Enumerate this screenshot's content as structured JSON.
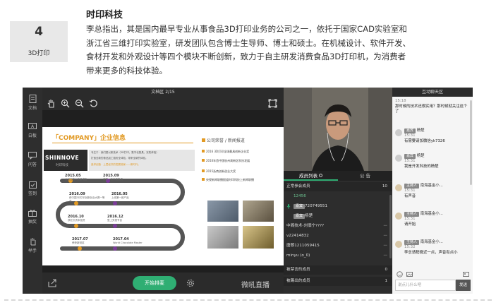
{
  "rank": {
    "number": "4",
    "category": "3D打印"
  },
  "company": {
    "name": "时印科技",
    "desc": "李总指出，其是国内最早专业从事食品3D打印业务的公司之一，依托于国家CAD实验室和浙江省三维打印实验室，研发团队包含博士生导师、博士和硕士。在机械设计、软件开发、食材开发和外观设计等四个模块不断创新，致力于自主研发消费食品3D打印机，为消费者带来更多的科技体验。"
  },
  "app": {
    "left_nav": [
      {
        "label": "文档",
        "icon": "document-icon"
      },
      {
        "label": "白板",
        "icon": "whiteboard-icon"
      },
      {
        "label": "问答",
        "icon": "qa-icon"
      },
      {
        "label": "签到",
        "icon": "checkin-icon"
      },
      {
        "label": "抽奖",
        "icon": "gift-icon"
      },
      {
        "label": "举手",
        "icon": "hand-icon"
      }
    ],
    "doc_title": "文档区 2/15",
    "slide": {
      "company_header": "「COMPANY」企业信息",
      "logo_text": "SHINNOVE",
      "logo_sub": "时印科技",
      "intro_lines": [
        "专注于 · 我们是以新技术（3D打印、数字化厨具、安防体验）",
        "打造全新的食品加工链安全体验，带来全新的体验。",
        "追求创造 · 上层经济的发展前景——新时代。"
      ],
      "milestones": [
        {
          "year": "2015.05",
          "text": "公司在杭州注册成立"
        },
        {
          "year": "2015.09",
          "text": "获第一轮天使投资"
        },
        {
          "year": "2016.09",
          "text": "获中国3D打印创新创业大赛一等奖"
        },
        {
          "year": "2016.05",
          "text": "上线第一款产品"
        },
        {
          "year": "2016.10",
          "text": "获红杉资本投资"
        },
        {
          "year": "2016.12",
          "text": "登上央视节目"
        },
        {
          "year": "2017.07",
          "text": "荣获新锐奖"
        },
        {
          "year": "2017.04",
          "text": "World Chocolate Master"
        }
      ],
      "news_header": "公司荣誉 / 新闻报道",
      "news": [
        "2016 3D打印全球最具创新企业奖",
        "2016年首中国杭州高新区科技发展",
        "2015浙商创新创业大奖",
        "央视新闻联播报道时印科技上新闻联播"
      ]
    },
    "start_button": "开始排麦",
    "brand": "微吼直播",
    "tabs": {
      "members": "成员列表",
      "notice": "公 告"
    },
    "members_section": {
      "label": "正常参会成员",
      "count": "10"
    },
    "members": [
      "12456",
      "720749551",
      "杨楚",
      "中阁技术-刘佃宁????",
      "v22414832",
      "唐朗1211059415",
      "minyu (o_0)"
    ],
    "member_tag": "嘉宾",
    "banned": {
      "label": "被禁言的成员",
      "count": "0"
    },
    "kicked": {
      "label": "被踢出的成员",
      "count": "1"
    },
    "chat_title": "互动聊天区",
    "messages": [
      {
        "name": "",
        "time": "15:18",
        "text": "那时候的技术还很实用？那时候就关注这个了"
      },
      {
        "name": "杨楚",
        "time": "15:31",
        "text": "有需要请加微信yk7326"
      },
      {
        "name": "杨楚",
        "time": "15:31",
        "text": "我是开发科技的杨楚"
      },
      {
        "name": "南海基金小...",
        "time": "15:31",
        "text": "有声音"
      },
      {
        "name": "南海基金小...",
        "time": "15:31",
        "text": "请开始"
      },
      {
        "name": "南海基金小...",
        "time": "15:32",
        "text": "李总请稍微近一点，声音有点小"
      }
    ],
    "chat_placeholder": "说点儿什么吧",
    "send_label": "发送"
  }
}
